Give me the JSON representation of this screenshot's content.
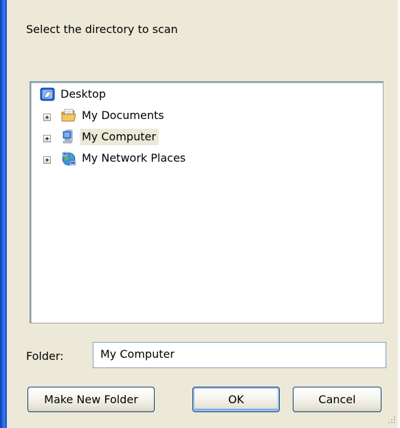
{
  "dialog": {
    "instruction": "Select the directory to scan"
  },
  "tree": {
    "items": [
      {
        "label": "Desktop",
        "icon": "desktop-icon",
        "expandable": false,
        "selected": false
      },
      {
        "label": "My Documents",
        "icon": "my-documents-folder-icon",
        "expandable": true,
        "selected": false
      },
      {
        "label": "My Computer",
        "icon": "my-computer-icon",
        "expandable": true,
        "selected": true
      },
      {
        "label": "My Network Places",
        "icon": "network-places-icon",
        "expandable": true,
        "selected": false
      }
    ]
  },
  "folder": {
    "label": "Folder:",
    "value": "My Computer"
  },
  "buttons": {
    "make_new_folder": "Make New Folder",
    "ok": "OK",
    "cancel": "Cancel"
  },
  "colors": {
    "dialog_background": "#ece9d8",
    "window_frame": "#0a3ea8",
    "input_border": "#7f9db9",
    "button_border": "#003c74"
  }
}
